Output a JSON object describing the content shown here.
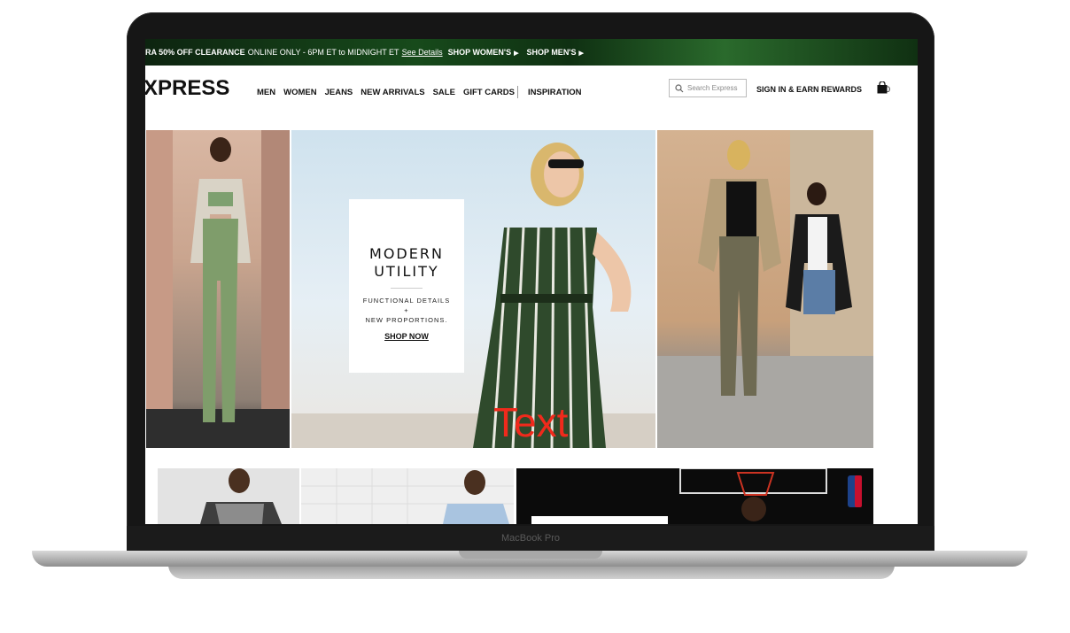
{
  "device": {
    "label": "MacBook Pro"
  },
  "promo_banner": {
    "headline": "RA 50% OFF CLEARANCE",
    "detail": "ONLINE ONLY - 6PM ET to MIDNIGHT ET",
    "see_details": "See Details",
    "shop_women": "SHOP WOMEN'S",
    "shop_men": "SHOP MEN'S"
  },
  "header": {
    "logo": "XPRESS",
    "nav": [
      "MEN",
      "WOMEN",
      "JEANS",
      "NEW ARRIVALS",
      "SALE",
      "GIFT CARDS",
      "INSPIRATION"
    ],
    "search_placeholder": "Search Express",
    "sign_in": "SIGN IN & EARN REWARDS",
    "bag_count": "0"
  },
  "hero": {
    "title_line1": "MODERN",
    "title_line2": "UTILITY",
    "text_line1": "FUNCTIONAL DETAILS",
    "text_plus": "+",
    "text_line2": "NEW PROPORTIONS.",
    "cta": "SHOP NOW",
    "overlay_text": "Text"
  },
  "colors": {
    "overlay_text": "#f02a1c",
    "promo_bg": "#174a1b"
  },
  "icons": {
    "search": "search-icon",
    "bag": "shopping-bag-icon",
    "caret": "caret-right-icon",
    "nba": "nba-logo-icon"
  }
}
